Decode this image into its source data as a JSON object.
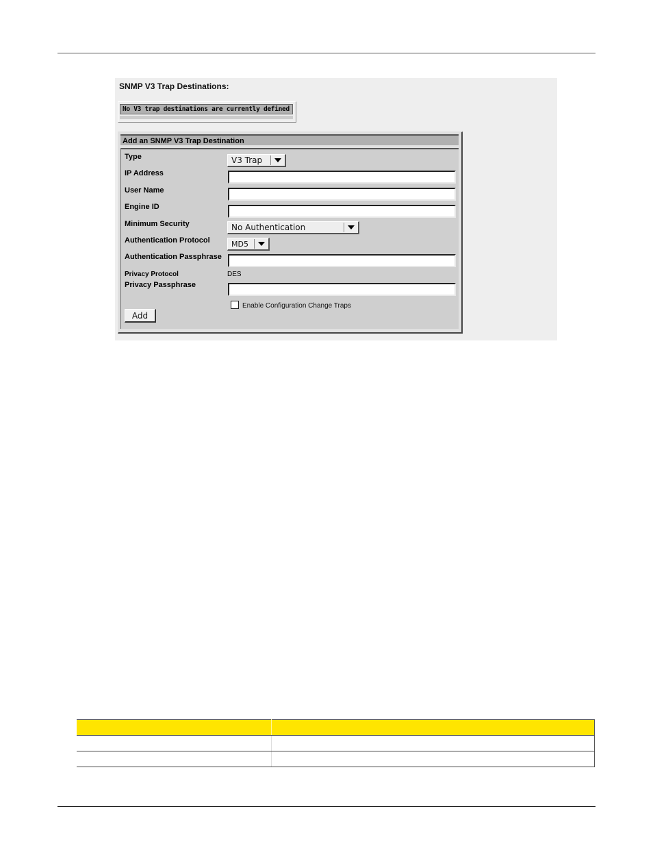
{
  "panel": {
    "title": "SNMP V3 Trap Destinations:",
    "empty_message": "No V3 trap destinations are currently defined"
  },
  "form": {
    "header": "Add an SNMP V3 Trap Destination",
    "fields": {
      "type": {
        "label": "Type",
        "value": "V3 Trap"
      },
      "ip_address": {
        "label": "IP Address",
        "value": ""
      },
      "user_name": {
        "label": "User Name",
        "value": ""
      },
      "engine_id": {
        "label": "Engine ID",
        "value": ""
      },
      "minimum_security": {
        "label": "Minimum Security",
        "value": "No Authentication"
      },
      "auth_protocol": {
        "label": "Authentication Protocol",
        "value": "MD5"
      },
      "auth_passphrase": {
        "label": "Authentication Passphrase",
        "value": ""
      },
      "privacy_protocol": {
        "label": "Privacy Protocol",
        "value": "DES"
      },
      "privacy_passphrase": {
        "label": "Privacy Passphrase",
        "value": ""
      }
    },
    "checkbox": {
      "label": "Enable Configuration Change Traps",
      "checked": false
    },
    "add_label": "Add"
  },
  "table": {
    "header": [
      "",
      ""
    ],
    "rows": [
      [
        "",
        ""
      ],
      [
        "",
        ""
      ]
    ],
    "header_color": "#ffe500"
  }
}
